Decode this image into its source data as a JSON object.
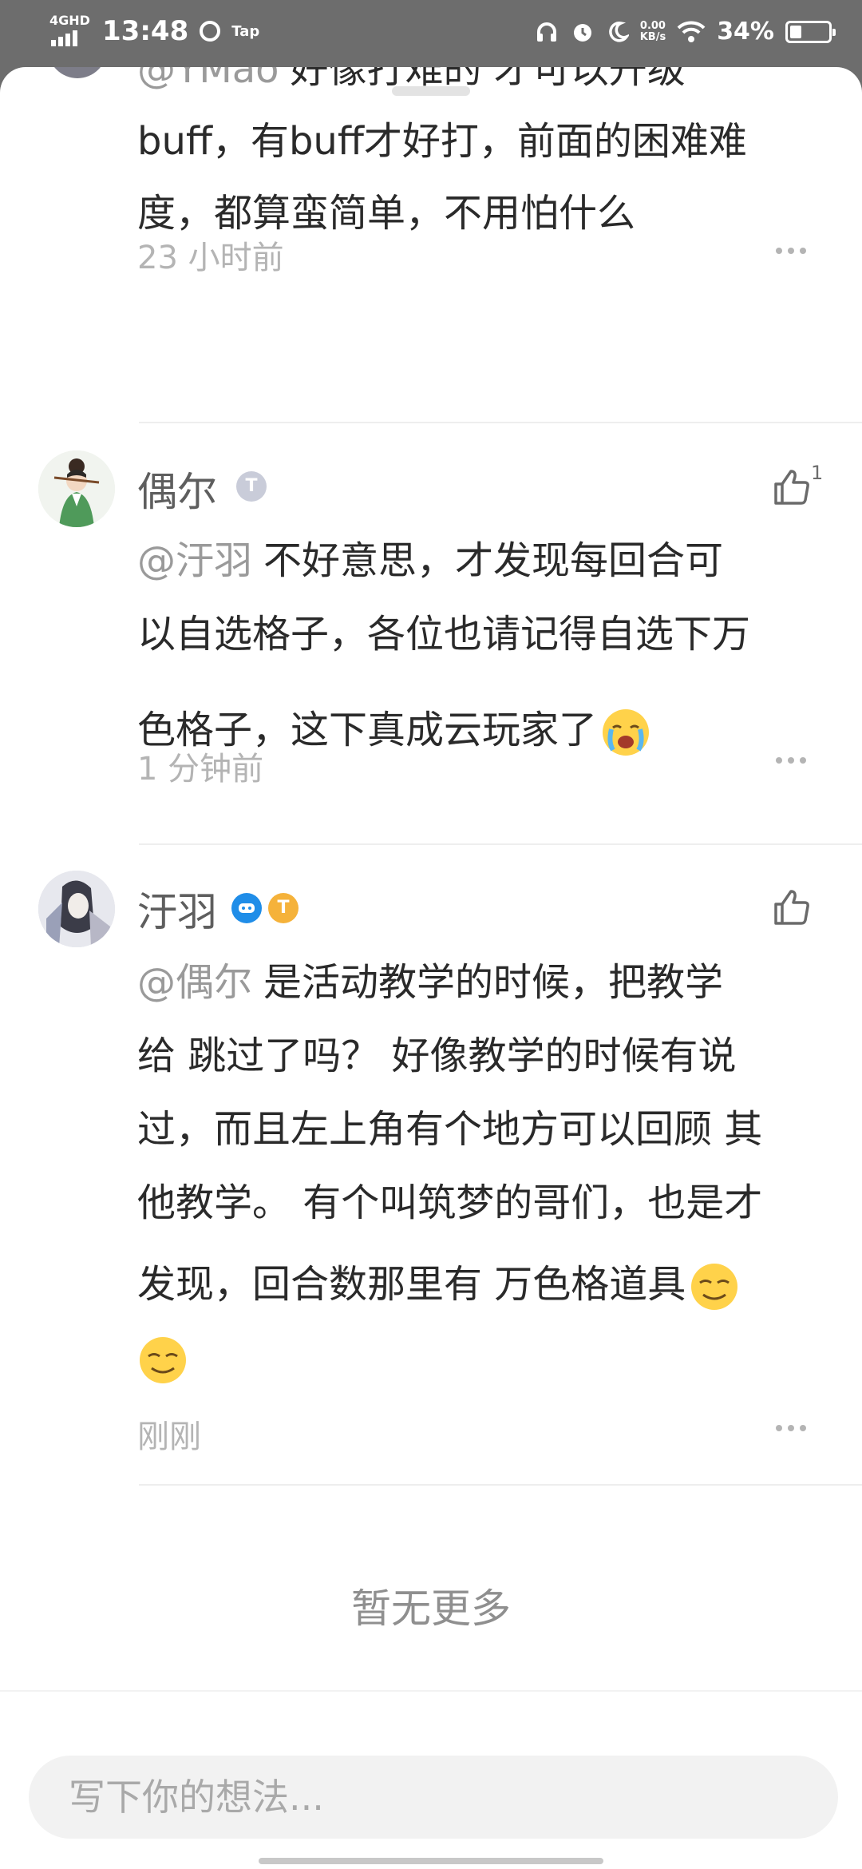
{
  "status_bar": {
    "network": "4GHD",
    "time": "13:48",
    "app_label": "Tap",
    "speed_value": "0.00",
    "speed_unit": "KB/s",
    "battery_percent": "34%",
    "battery_level": 0.34
  },
  "comments": [
    {
      "mention": "@YMao",
      "text_lines": [
        "好像打难的 才可以升级",
        "buff，有buff才好打，前面的困难难",
        "度，都算蛮简单，不用怕什么"
      ],
      "time": "23 小时前"
    },
    {
      "username": "偶尔",
      "like_count": "1",
      "mention": "@汙羽",
      "text_lines": [
        "不好意思，才发现每回合可",
        "以自选格子，各位也请记得自选下万",
        "色格子，这下真成云玩家了"
      ],
      "emoji": "crying-emoji",
      "time": "1 分钟前"
    },
    {
      "username": "汙羽",
      "mention": "@偶尔",
      "text_lines": [
        "是活动教学的时候，把教学",
        "给 跳过了吗？ 好像教学的时候有说",
        "过，而且左上角有个地方可以回顾 其",
        "他教学。 有个叫筑梦的哥们，也是才",
        "发现，回合数那里有 万色格道具"
      ],
      "emoji": "smirk-emoji",
      "time": "刚刚"
    }
  ],
  "no_more_text": "暂无更多",
  "input_placeholder": "写下你的想法..."
}
